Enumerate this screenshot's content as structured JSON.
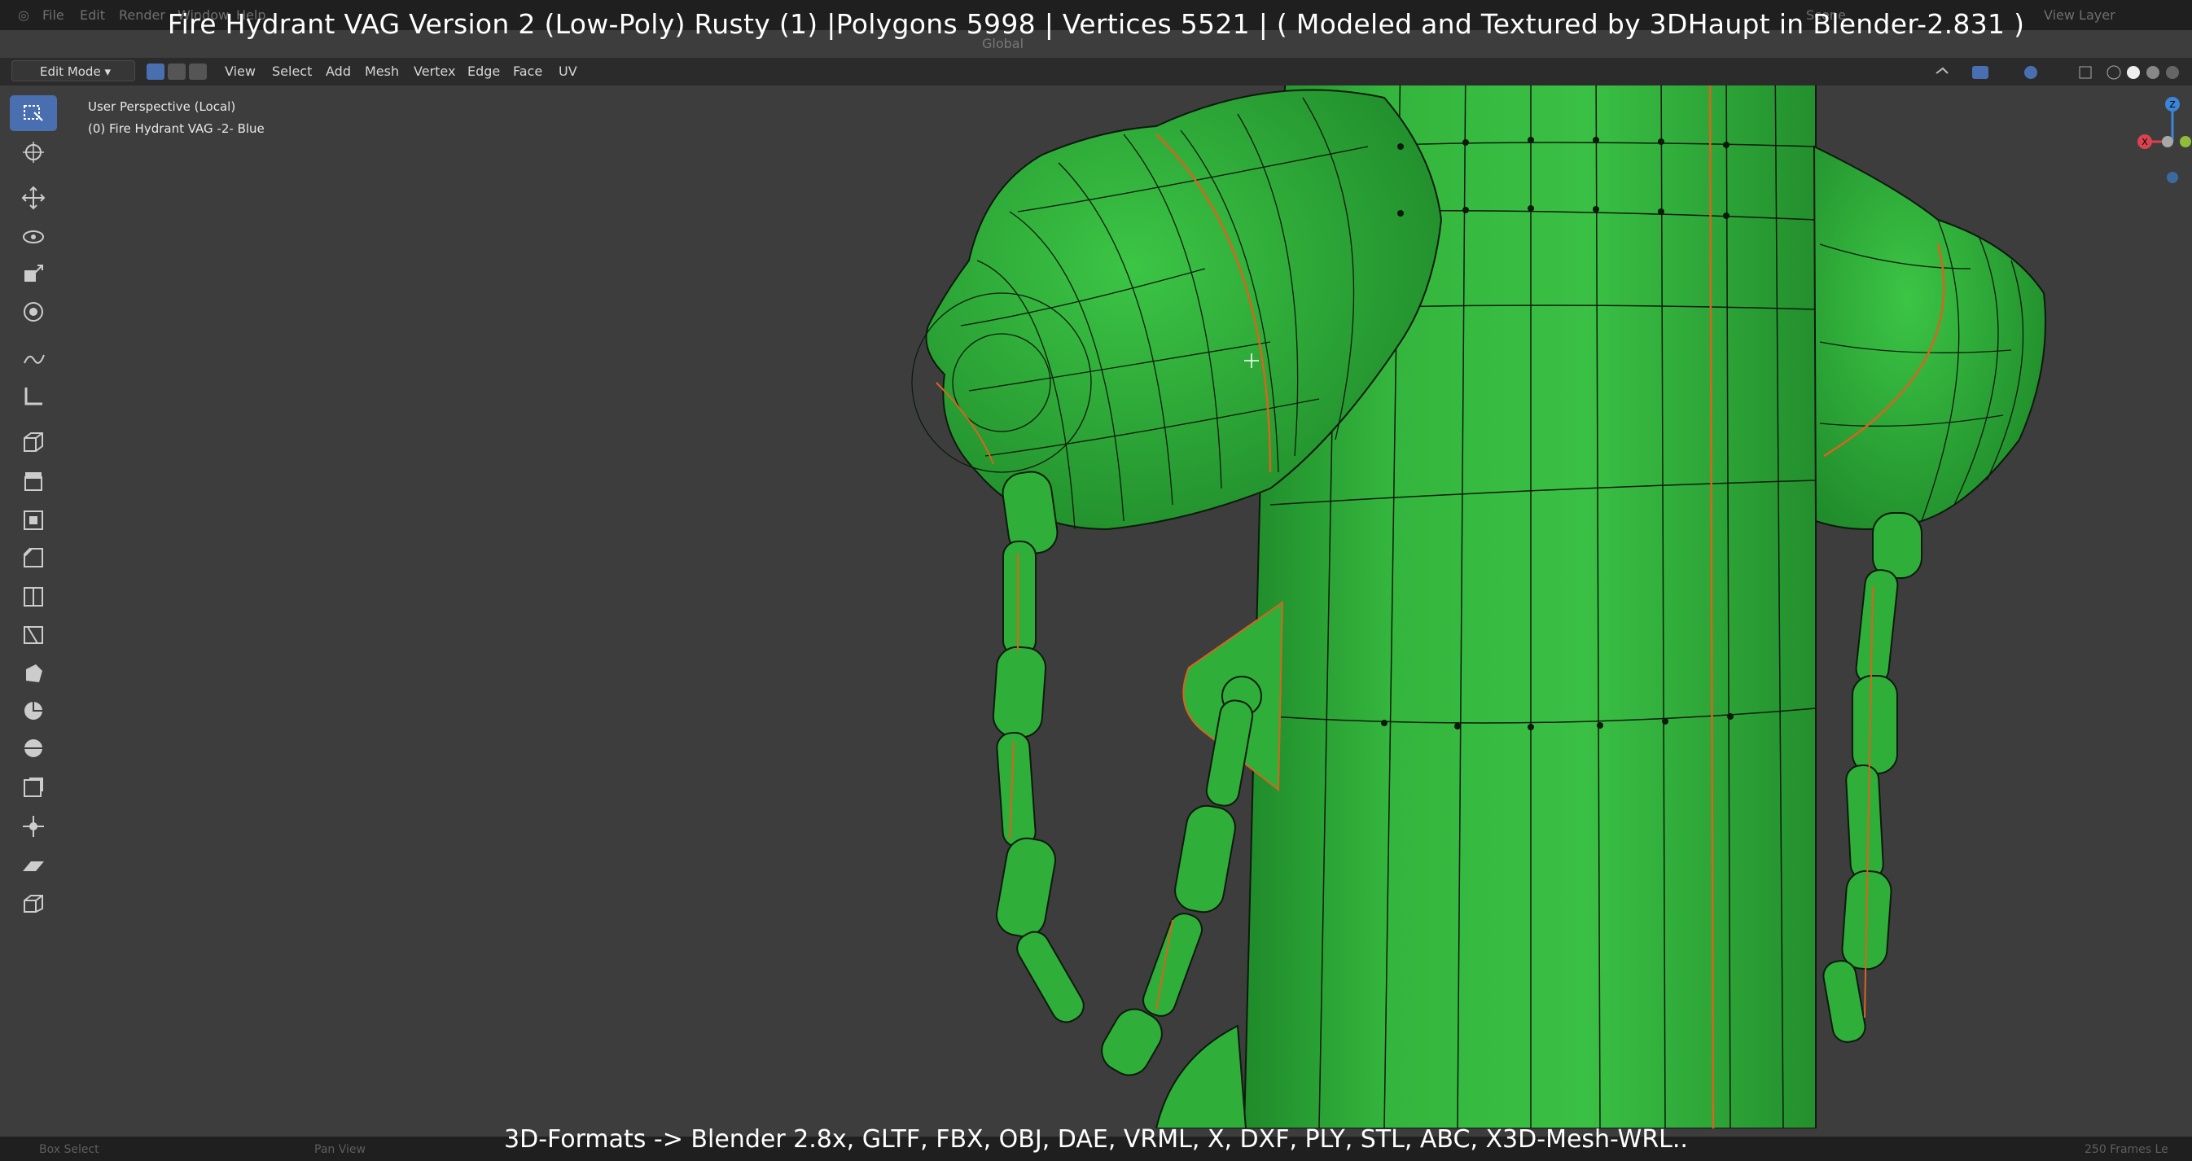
{
  "title_overlay": "Fire Hydrant VAG Version 2 (Low-Poly) Rusty (1) |Polygons 5998 | Vertices 5521 | ( Modeled and Textured by 3DHaupt in Blender-2.831 )",
  "top_menu": [
    "File",
    "Edit",
    "Render",
    "Window",
    "Help"
  ],
  "top_right": {
    "scene": "Scene",
    "view_layer": "View Layer"
  },
  "header": {
    "mode": "Edit Mode",
    "menus": [
      "View",
      "Select",
      "Add",
      "Mesh",
      "Vertex",
      "Edge",
      "Face",
      "UV"
    ],
    "transform_orientation": "Global"
  },
  "viewport_info": {
    "perspective": "User Perspective (Local)",
    "object": "(0) Fire Hydrant VAG -2- Blue"
  },
  "toolbar_tools": [
    "select-box-icon",
    "cursor-icon",
    "move-icon",
    "rotate-icon",
    "scale-icon",
    "transform-icon",
    "annotate-icon",
    "measure-icon",
    "add-cube-icon",
    "extrude-icon",
    "inset-icon",
    "bevel-icon",
    "loop-cut-icon",
    "knife-icon",
    "poly-build-icon",
    "spin-icon",
    "smooth-icon",
    "edge-slide-icon",
    "shrink-fatten-icon",
    "shear-icon",
    "rip-icon"
  ],
  "gizmo_axes": {
    "z": "Z",
    "x": "X",
    "y": "Y"
  },
  "bottom_overlay": "3D-Formats -> Blender 2.8x, GLTF, FBX, OBJ, DAE, VRML, X, DXF, PLY, STL, ABC, X3D-Mesh-WRL..",
  "status": {
    "left": "Box Select",
    "middle": "Pan View",
    "right": "250 Frames Le"
  },
  "colors": {
    "mesh_green": "#2fae3a",
    "edge_black": "#0d1a0d",
    "seam_orange": "#d8641e",
    "viewport_bg": "#3d3d3d",
    "active_tool": "#4a6fb0"
  }
}
